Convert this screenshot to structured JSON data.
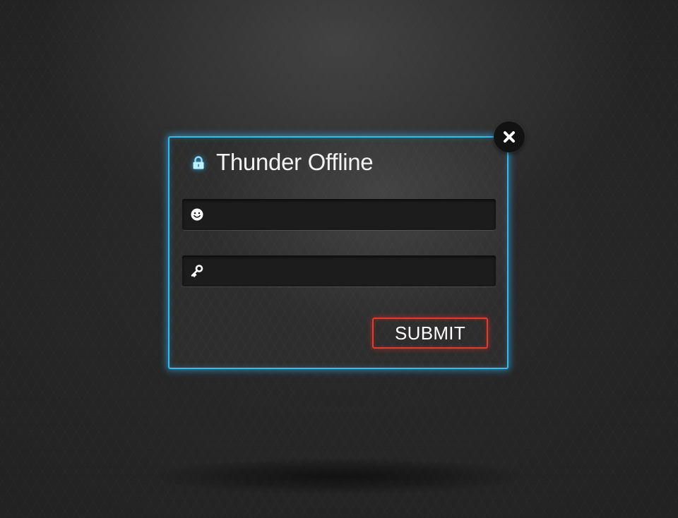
{
  "dialog": {
    "title": "Thunder Offline",
    "lock_icon": "lock-icon",
    "close_icon": "close-icon"
  },
  "form": {
    "username": {
      "icon": "smiley-user-icon",
      "value": "",
      "placeholder": ""
    },
    "password": {
      "icon": "key-icon",
      "value": "",
      "placeholder": ""
    },
    "submit_label": "SUBMIT"
  },
  "colors": {
    "accent_glow": "#3ab8ea",
    "submit_border": "#e23a2c",
    "background": "#222222",
    "text": "#f2f2f2"
  }
}
